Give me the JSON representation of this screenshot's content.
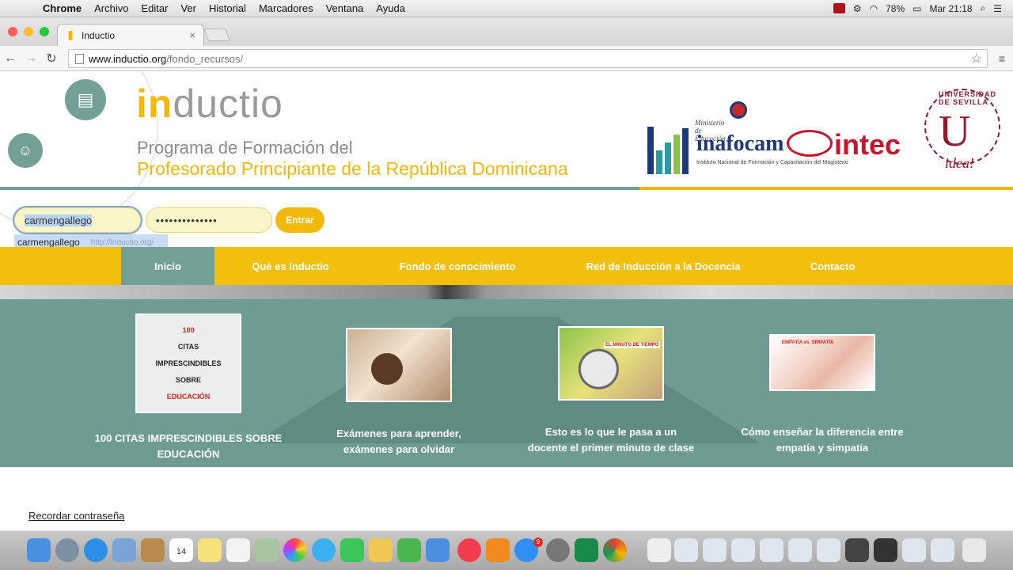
{
  "menubar": {
    "app": "Chrome",
    "items": [
      "Archivo",
      "Editar",
      "Ver",
      "Historial",
      "Marcadores",
      "Ventana",
      "Ayuda"
    ],
    "battery": "78%",
    "clock": "Mar 21:18"
  },
  "browser": {
    "tab_title": "Inductio",
    "tab_close": "×",
    "url_host": "www.inductio.org",
    "url_path": "/fondo_recursos/"
  },
  "header": {
    "logo_in": "in",
    "logo_rest": "ductio",
    "subtitle1": "Programa de Formación del",
    "subtitle2": "Profesorado Principiante de la República Dominicana",
    "partners": {
      "ministerio": "Ministerio de Educación",
      "inafocam": "inafocam",
      "inafocam_sub": "Instituto Nacional de Formación y Capacitación del Magisterio",
      "intec": "intec",
      "sevilla_top": "UNIVERSIDAD DE SEVILLA",
      "sevilla_u": "U",
      "sevilla_idea": "idea!"
    }
  },
  "login": {
    "username": "carmengallego",
    "password": "••••••••••••••",
    "submit": "Entrar",
    "autocomplete_user": "carmengallego",
    "autocomplete_url": "http://inductio.org/"
  },
  "nav": {
    "items": [
      "Inicio",
      "Qué es Inductio",
      "Fondo de conocimiento",
      "Red de Inducción a la Docencia",
      "Contacto"
    ],
    "active_index": 0
  },
  "cards": [
    {
      "quote_lines": [
        "100",
        "CITAS",
        "IMPRESCINDIBLES",
        "SOBRE",
        "EDUCACIÓN"
      ],
      "caption_l1": "100 CITAS IMPRESCINDIBLES SOBRE",
      "caption_l2": "EDUCACIÓN"
    },
    {
      "caption_l1": "Exámenes para aprender,",
      "caption_l2": "exámenes para olvidar"
    },
    {
      "thumb_tag": "EL MINUTO DE TIEMPO",
      "caption_l1": "Esto es lo que le pasa a un",
      "caption_l2": "docente el primer minuto de clase"
    },
    {
      "thumb_tag": "EMPATÍA vs. SIMPATÍA",
      "caption_l1": "Cómo enseñar la diferencia entre",
      "caption_l2": "empatía y simpatía"
    }
  ],
  "footer": {
    "forgot_password": "Recordar contraseña"
  },
  "dock": {
    "calendar_day": "14",
    "appstore_badge": "9"
  },
  "colors": {
    "accent_yellow": "#f2bf0c",
    "teal": "#72a096",
    "teal_banner": "#6e9c93"
  }
}
